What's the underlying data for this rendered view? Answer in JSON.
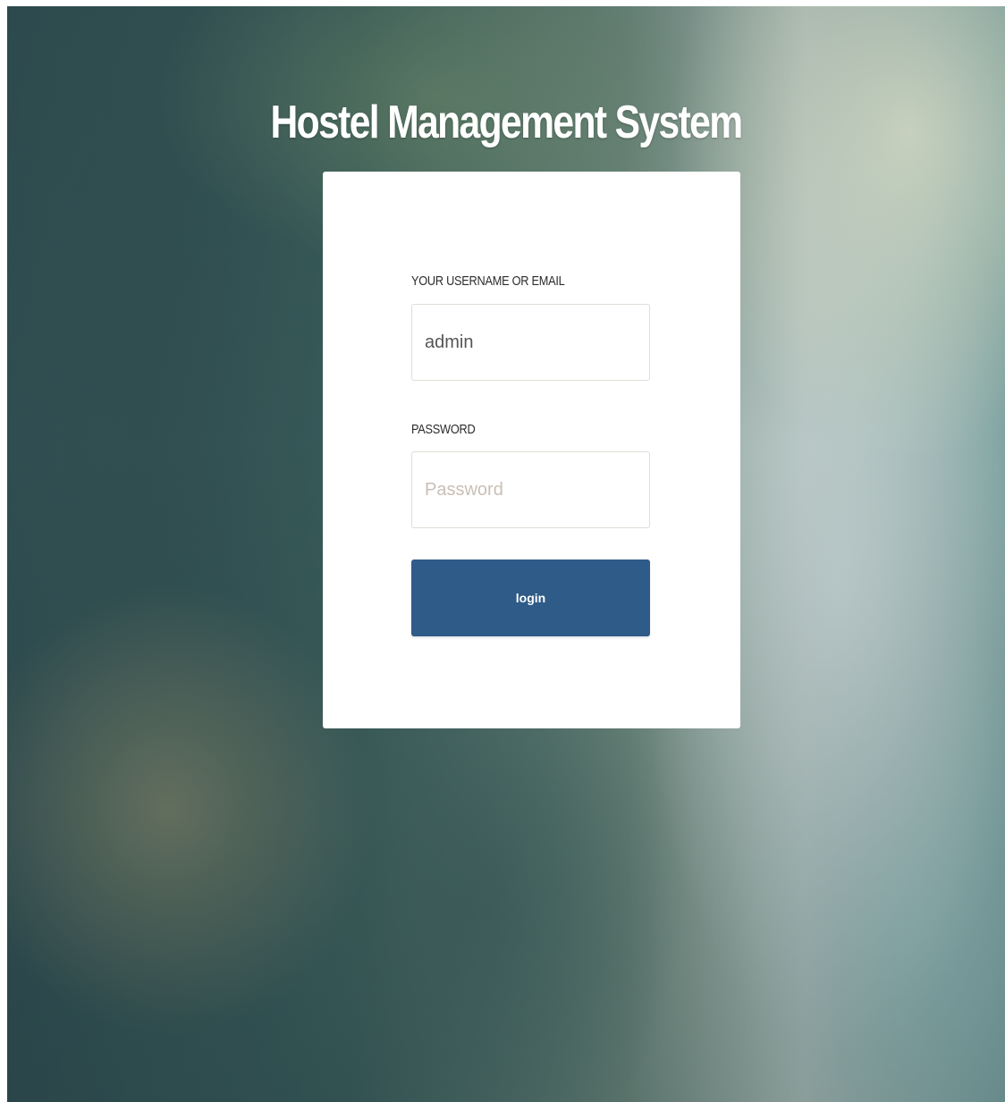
{
  "page": {
    "title": "Hostel Management System"
  },
  "login_form": {
    "username_label": "YOUR USERNAME OR EMAIL",
    "username_value": "admin",
    "password_label": "PASSWORD",
    "password_placeholder": "Password",
    "submit_label": "login"
  },
  "colors": {
    "button": "#2f5b88",
    "card": "#ffffff",
    "title": "#ffffff"
  }
}
